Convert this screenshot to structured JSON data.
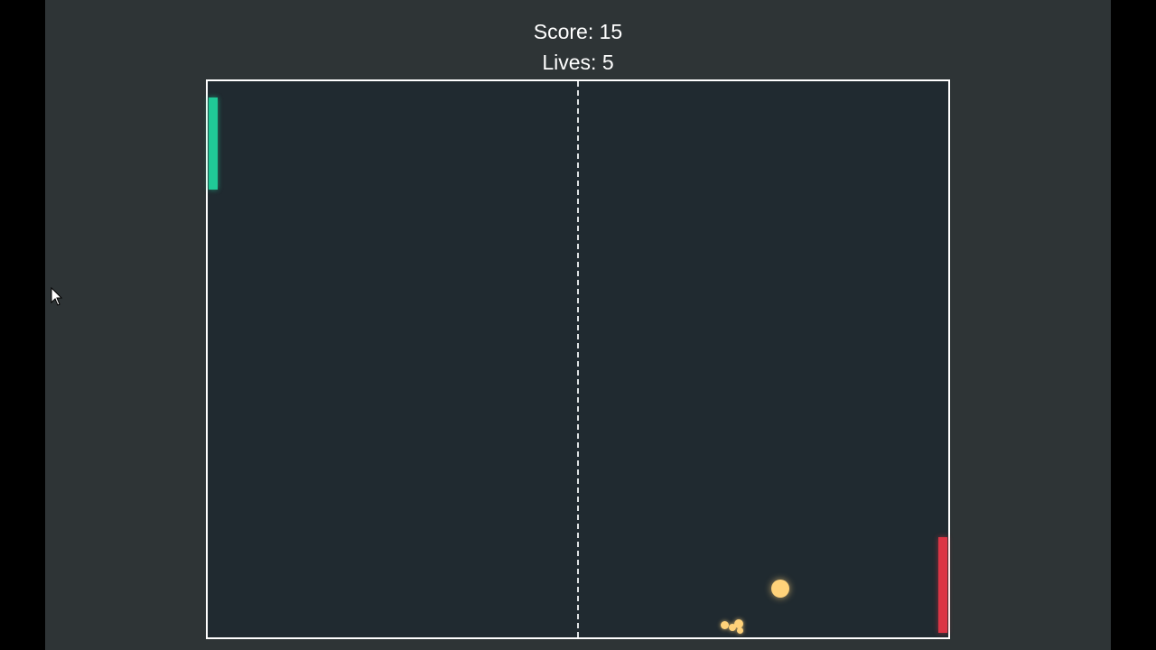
{
  "hud": {
    "score_text": "Score: 15",
    "lives_text": "Lives: 5"
  },
  "colors": {
    "page_background": "#2e3436",
    "board_background": "#202a30",
    "board_border": "#ffffff",
    "left_paddle": "#20c997",
    "right_paddle": "#dc3545",
    "ball": "#ffd27a"
  },
  "icons": {
    "cursor": "mouse-pointer-icon"
  }
}
